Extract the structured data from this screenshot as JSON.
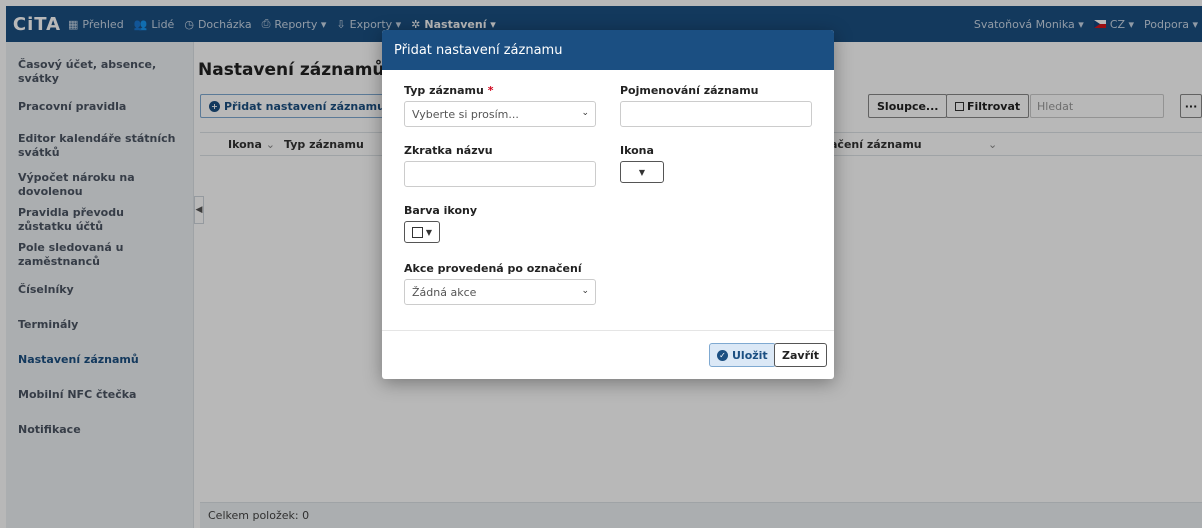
{
  "nav": {
    "logo": "CiTA",
    "items": [
      {
        "label": "Přehled",
        "icon": "grid-icon"
      },
      {
        "label": "Lidé",
        "icon": "people-icon"
      },
      {
        "label": "Docházka",
        "icon": "clock-icon"
      },
      {
        "label": "Reporty ▾",
        "icon": "printer-icon"
      },
      {
        "label": "Exporty ▾",
        "icon": "export-icon"
      },
      {
        "label": "Nastavení ▾",
        "icon": "gear-icon"
      }
    ],
    "user": "Svatoňová Monika ▾",
    "language": "CZ ▾",
    "support": "Podpora ▾"
  },
  "sidebar": {
    "items": [
      {
        "label": "Časový účet, absence, svátky"
      },
      {
        "label": "Pracovní pravidla"
      },
      {
        "label": "Editor kalendáře státních svátků"
      },
      {
        "label": "Výpočet nároku na dovolenou"
      },
      {
        "label": "Pravidla převodu zůstatku účtů"
      },
      {
        "label": "Pole sledovaná u zaměstnanců"
      },
      {
        "label": "Číselníky"
      },
      {
        "label": "Terminály"
      },
      {
        "label": "Nastavení záznamů"
      },
      {
        "label": "Mobilní NFC čtečka"
      },
      {
        "label": "Notifikace"
      }
    ],
    "active_index": 8
  },
  "main": {
    "title": "Nastavení záznamů",
    "add_button": "Přidat nastavení záznamu",
    "columns_button": "Sloupce...",
    "filter_button": "Filtrovat",
    "search_placeholder": "Hledat",
    "more_button": "···",
    "columns": [
      "Ikona",
      "Typ záznamu",
      "ačení záznamu"
    ],
    "footer": "Celkem položek: 0"
  },
  "modal": {
    "title": "Přidat nastavení záznamu",
    "type_label": "Typ záznamu",
    "required_mark": "*",
    "type_placeholder": "Vyberte si prosím...",
    "name_label": "Pojmenování záznamu",
    "short_label": "Zkratka názvu",
    "icon_label": "Ikona",
    "color_label": "Barva ikony",
    "action_label": "Akce provedená po označení",
    "action_value": "Žádná akce",
    "save_button": "Uložit",
    "close_button": "Zavřít"
  }
}
